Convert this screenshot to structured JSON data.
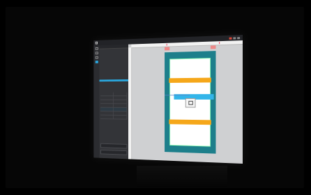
{
  "window": {
    "title": "",
    "controls": [
      "minimize",
      "maximize",
      "close"
    ]
  },
  "rail": {
    "icons": [
      "page-icon",
      "layers-icon",
      "data-icon",
      "settings-icon"
    ]
  },
  "panel": {
    "header": "",
    "tree_nodes": [
      "",
      "",
      "",
      "",
      "",
      "",
      "",
      "",
      ""
    ],
    "grid_rows": [
      [
        "",
        ""
      ],
      [
        "",
        ""
      ],
      [
        "",
        ""
      ],
      [
        "",
        ""
      ],
      [
        "",
        ""
      ],
      [
        "",
        ""
      ],
      [
        "",
        ""
      ]
    ],
    "footer_fields": [
      "",
      ""
    ]
  },
  "colors": {
    "app_bg": "#000000",
    "panel_bg": "#333438",
    "selection": "#2aa7de",
    "page_frame": "#1d7f8b",
    "band": "#f5a71a",
    "selected_row": "#33b5e9"
  }
}
